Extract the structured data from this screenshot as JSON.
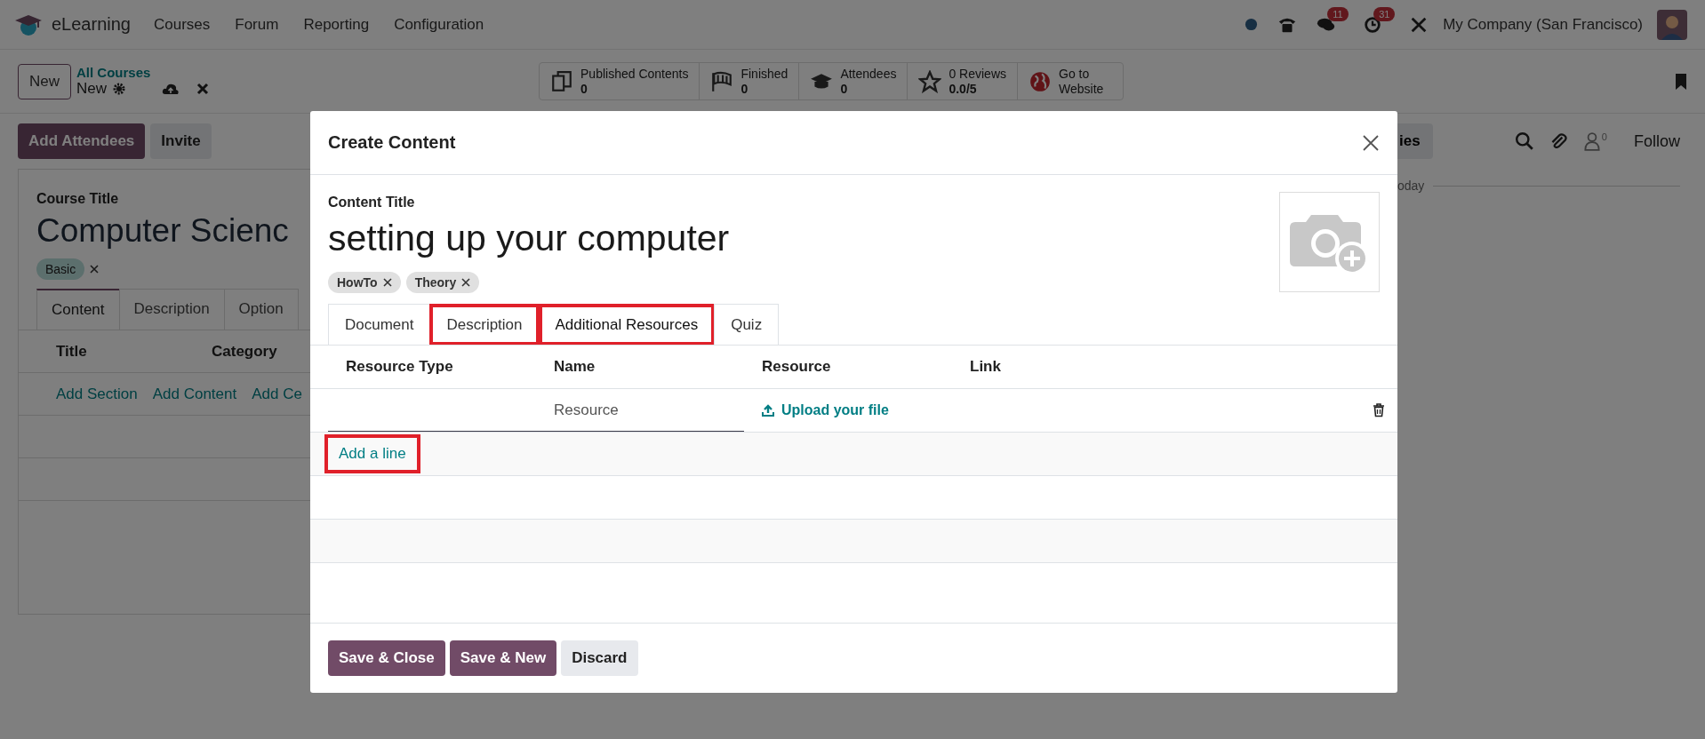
{
  "navbar": {
    "app_name": "eLearning",
    "menus": [
      "Courses",
      "Forum",
      "Reporting",
      "Configuration"
    ],
    "messages_badge": "11",
    "activities_badge": "31",
    "company": "My Company (San Francisco)"
  },
  "control_panel": {
    "new_button": "New",
    "breadcrumb": "All Courses",
    "record": "New",
    "stats": [
      {
        "kind": "contents",
        "label": "Published Contents",
        "value": "0"
      },
      {
        "kind": "finished",
        "label": "Finished",
        "value": "0"
      },
      {
        "kind": "attendees",
        "label": "Attendees",
        "value": "0"
      },
      {
        "kind": "reviews",
        "label": "0 Reviews",
        "value": "0.0/5"
      },
      {
        "kind": "website",
        "label": "Go to Website"
      }
    ]
  },
  "course": {
    "actions": [
      "Add Attendees",
      "Invite"
    ],
    "title_label": "Course Title",
    "title": "Computer Scienc",
    "tags": [
      "Basic"
    ],
    "tabs": [
      {
        "label": "Content",
        "selected": true
      },
      {
        "label": "Description",
        "selected": false
      },
      {
        "label": "Option",
        "selected": false
      }
    ],
    "columns": [
      "Title",
      "Category"
    ],
    "add_links": [
      "Add Section",
      "Add Content",
      "Add Ce"
    ]
  },
  "chatter": {
    "button": "ies",
    "followers": "0",
    "follow": "Follow",
    "date_label": "oday"
  },
  "dialog": {
    "title": "Create Content",
    "field_label": "Content Title",
    "content_title": "setting up your computer",
    "tags": [
      "HowTo",
      "Theory"
    ],
    "tabs": [
      {
        "label": "Document",
        "selected": false,
        "highlighted": false
      },
      {
        "label": "Description",
        "selected": false,
        "highlighted": true
      },
      {
        "label": "Additional Resources",
        "selected": true,
        "highlighted": true
      },
      {
        "label": "Quiz",
        "selected": false,
        "highlighted": false
      }
    ],
    "columns": [
      "Resource Type",
      "Name",
      "Resource",
      "Link"
    ],
    "rows": [
      {
        "name_placeholder": "Resource",
        "upload": "Upload your file"
      }
    ],
    "add_line": {
      "label": "Add a line",
      "highlighted": true
    },
    "buttons": [
      {
        "label": "Save & Close",
        "kind": "primary"
      },
      {
        "label": "Save & New",
        "kind": "primary"
      },
      {
        "label": "Discard",
        "kind": "secondary"
      }
    ]
  }
}
